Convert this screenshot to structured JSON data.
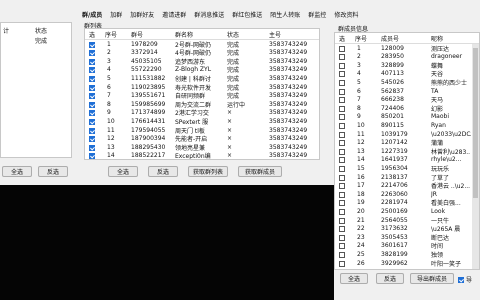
{
  "tabs": [
    "群/成员",
    "加群",
    "加群好友",
    "邀请进群",
    "群消息推送",
    "群红包推送",
    "陌生人转账",
    "群监控",
    "修改资料"
  ],
  "left_panel": {
    "col_suffix": "计",
    "status_header": "状态",
    "status_value": "完成",
    "btn_select_all": "全选",
    "btn_invert": "反选"
  },
  "group_list": {
    "title": "群列表",
    "columns": [
      "选",
      "序号",
      "群号",
      "群名称",
      "状态",
      "主号"
    ],
    "rows": [
      {
        "no": "1",
        "num": "1978209",
        "name": "2号群-网破仍",
        "status": "完成",
        "main": "3583743249"
      },
      {
        "no": "2",
        "num": "3372914",
        "name": "4号群-网破仍",
        "status": "完成",
        "main": "3583743249"
      },
      {
        "no": "3",
        "num": "45035105",
        "name": "追梦西游东",
        "status": "完成",
        "main": "3583743249"
      },
      {
        "no": "4",
        "num": "55722290",
        "name": "Z-Blogh ZYL",
        "status": "完成",
        "main": "3583743249"
      },
      {
        "no": "5",
        "num": "111531882",
        "name": "创建 | 科群讨",
        "status": "完成",
        "main": "3583743249"
      },
      {
        "no": "6",
        "num": "119023895",
        "name": "寿光软件开发",
        "status": "完成",
        "main": "3583743249"
      },
      {
        "no": "7",
        "num": "139551671",
        "name": "自研同频群",
        "status": "完成",
        "main": "3583743249"
      },
      {
        "no": "8",
        "num": "159985699",
        "name": "周为交流二群",
        "status": "运行中",
        "main": "3583743249"
      },
      {
        "no": "9",
        "num": "171374899",
        "name": "2港汇学习交",
        "status": "×",
        "main": "3583743249"
      },
      {
        "no": "10",
        "num": "176614431",
        "name": "SPextert 服",
        "status": "×",
        "main": "3583743249"
      },
      {
        "no": "11",
        "num": "179594055",
        "name": "周天门 tl板",
        "status": "×",
        "main": "3583743249"
      },
      {
        "no": "12",
        "num": "187900394",
        "name": "先能者-开启",
        "status": "×",
        "main": "3583743249"
      },
      {
        "no": "13",
        "num": "188295430",
        "name": "领地亮星兼",
        "status": "×",
        "main": "3583743249"
      },
      {
        "no": "14",
        "num": "188522217",
        "name": "Excepti0n编",
        "status": "×",
        "main": "3583743249"
      }
    ],
    "btn_select_all": "全选",
    "btn_invert": "反选",
    "btn_get_groups": "获取群列表",
    "btn_get_members": "获取群成员"
  },
  "member_info": {
    "title": "群成员信息",
    "columns": [
      "选",
      "序号",
      "成员号",
      "昵称"
    ],
    "rows": [
      {
        "no": "1",
        "num": "128009",
        "nick": "测压达"
      },
      {
        "no": "2",
        "num": "283950",
        "nick": "dragoneer"
      },
      {
        "no": "3",
        "num": "328899",
        "nick": "蝶舞"
      },
      {
        "no": "4",
        "num": "407113",
        "nick": "天谷"
      },
      {
        "no": "5",
        "num": "545026",
        "nick": "熊熊的西少士"
      },
      {
        "no": "6",
        "num": "562837",
        "nick": "TA"
      },
      {
        "no": "7",
        "num": "666238",
        "nick": "天马"
      },
      {
        "no": "8",
        "num": "724406",
        "nick": "幻影"
      },
      {
        "no": "9",
        "num": "850201",
        "nick": "Maobi"
      },
      {
        "no": "10",
        "num": "890115",
        "nick": "Ryan"
      },
      {
        "no": "11",
        "num": "1039179",
        "nick": "\\u2033\\u2DCA"
      },
      {
        "no": "12",
        "num": "1207142",
        "nick": "蒲蒲"
      },
      {
        "no": "13",
        "num": "1227319",
        "nick": "林曾利\\u283.."
      },
      {
        "no": "14",
        "num": "1641937",
        "nick": "rhyle\\u2..."
      },
      {
        "no": "15",
        "num": "1956304",
        "nick": "玩玩乐"
      },
      {
        "no": "16",
        "num": "2138137",
        "nick": "了草了"
      },
      {
        "no": "17",
        "num": "2214706",
        "nick": "香港云 ..\\u2..."
      },
      {
        "no": "18",
        "num": "2263060",
        "nick": "JR"
      },
      {
        "no": "19",
        "num": "2281974",
        "nick": "看美白强..."
      },
      {
        "no": "20",
        "num": "2500169",
        "nick": "Look"
      },
      {
        "no": "21",
        "num": "2564055",
        "nick": "一只牛"
      },
      {
        "no": "22",
        "num": "3173632",
        "nick": "\\u265A 晨"
      },
      {
        "no": "23",
        "num": "3505453",
        "nick": "断巴达"
      },
      {
        "no": "24",
        "num": "3601617",
        "nick": "时间"
      },
      {
        "no": "25",
        "num": "3828199",
        "nick": "独领"
      },
      {
        "no": "26",
        "num": "3929962",
        "nick": "叶阳一笑子"
      }
    ],
    "btn_select_all": "全选",
    "btn_invert": "反选",
    "btn_export": "导出群成员",
    "chk_label": "导"
  }
}
